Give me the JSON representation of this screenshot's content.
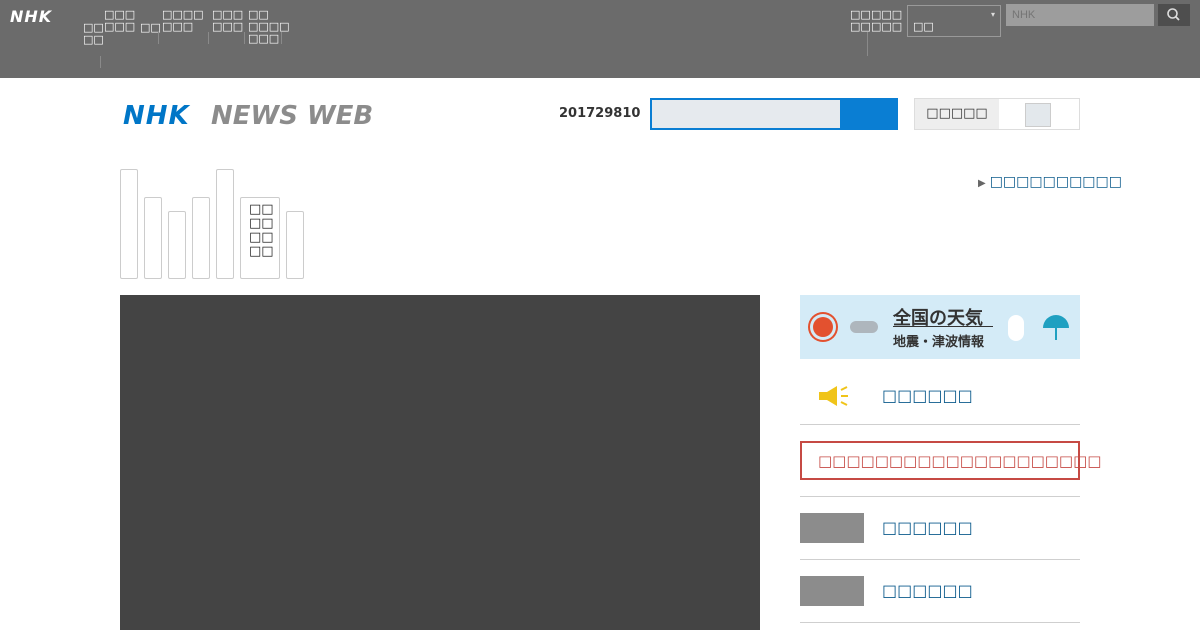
{
  "topbar": {
    "logo": "NHK",
    "nav": [
      "□□\n□□",
      "□□□\n□□□",
      "□□",
      "□□□□\n□□□",
      "□□□\n□□□",
      "□□\n□□□□\n□□□"
    ],
    "right_nav": [
      "□□\n□□",
      "□□□\n□□□"
    ],
    "select_value": "□□",
    "search_placeholder": "NHK"
  },
  "header": {
    "logo_nhk": "NHK",
    "logo_newsweb": "NEWS WEB",
    "date": "201729810",
    "text_size_label": "□□□□□"
  },
  "tabs": [
    "",
    "",
    "",
    "",
    "",
    "□□\n□□\n□□\n□□",
    ""
  ],
  "special_link": "□□□□□□□□□□",
  "weather": {
    "title": "全国の天気",
    "subtitle": "地震・津波情報"
  },
  "right_links": {
    "news_alert": "□□□□□□",
    "alert_box": "□□□□□□□□□□□□□□□□□□□□",
    "item1": "□□□□□□",
    "item2": "□□□□□□"
  },
  "colors": {
    "brand_blue": "#0076c7",
    "link_blue": "#0d5b8c",
    "alert_red": "#c64a44",
    "topbar_gray": "#6b6b6b"
  }
}
